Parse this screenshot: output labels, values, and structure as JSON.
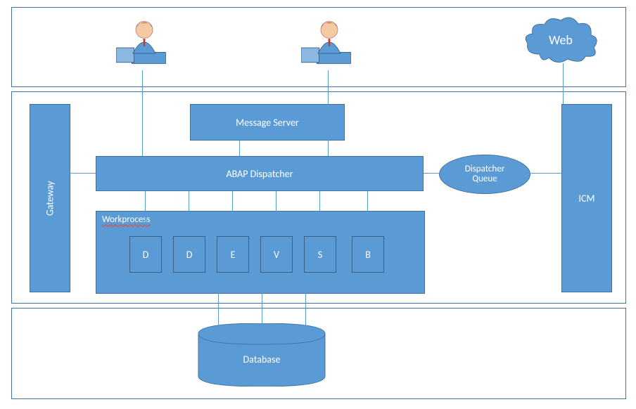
{
  "top": {
    "web": "Web"
  },
  "middle": {
    "gateway": "Gateway",
    "message_server": "Message Server",
    "abap_dispatcher": "ABAP Dispatcher",
    "dispatcher_queue_l1": "Dispatcher",
    "dispatcher_queue_l2": "Queue",
    "icm": "ICM",
    "workprocess_label": "Workprocess",
    "wp": [
      "D",
      "D",
      "E",
      "V",
      "S",
      "B"
    ]
  },
  "bottom": {
    "database": "Database"
  }
}
